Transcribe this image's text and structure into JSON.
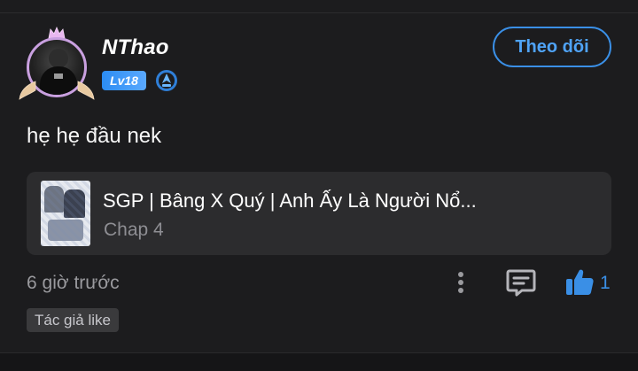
{
  "post": {
    "author": {
      "name": "NThao",
      "level": "Lv18"
    },
    "follow_label": "Theo dõi",
    "text": "hẹ hẹ đầu nek",
    "story": {
      "title": "SGP | Bâng X Quý | Anh Ấy Là Người Nổ...",
      "chapter": "Chap 4"
    },
    "timestamp": "6 giờ trước",
    "likes": "1",
    "tag": "Tác giả like"
  },
  "icons": {
    "rank": "rank-emblem-icon",
    "more": "more-vertical-icon",
    "comment": "comment-icon",
    "like": "thumbs-up-icon"
  },
  "colors": {
    "background": "#1c1c1e",
    "card": "#2c2c2e",
    "accent": "#3a8fe6",
    "level_badge": "#2c8cf2",
    "muted_text": "#9a9a9e"
  }
}
